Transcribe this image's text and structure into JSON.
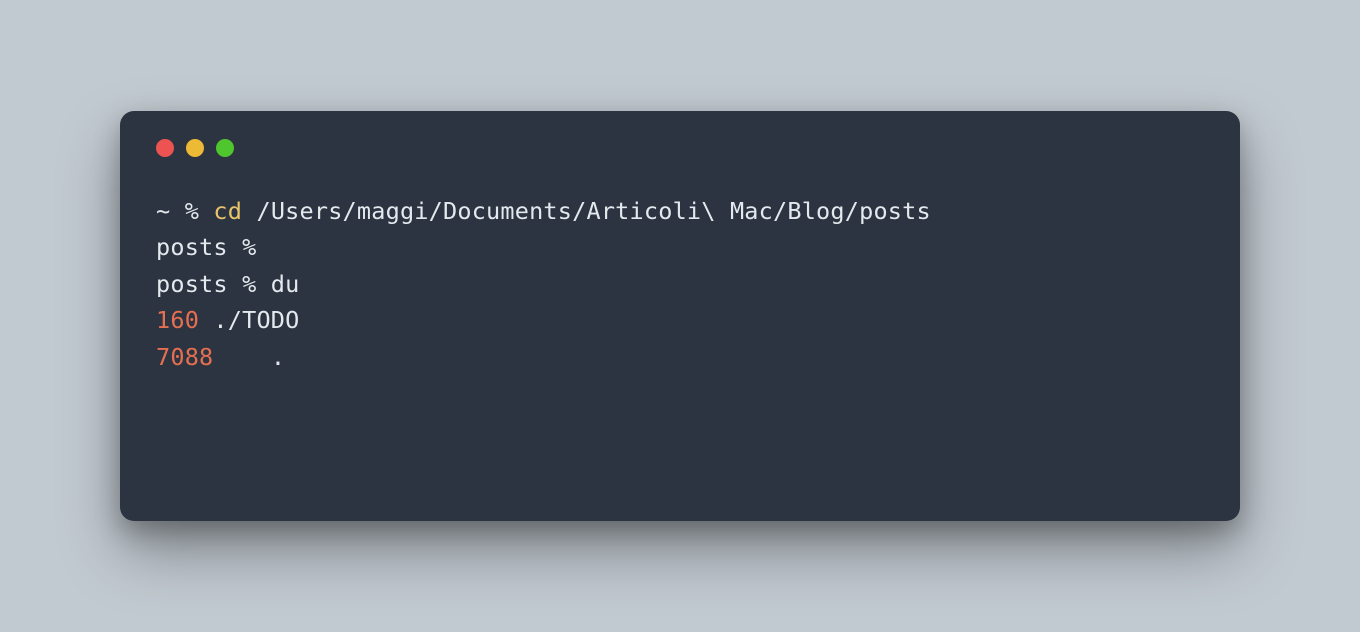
{
  "lines": [
    {
      "prompt": "~ %",
      "command": "cd",
      "arg": "/Users/maggi/Documents/Articoli\\ Mac/Blog/posts"
    },
    {
      "prompt": "posts %",
      "command": "",
      "arg": ""
    },
    {
      "prompt": "posts %",
      "command": "du",
      "arg": ""
    }
  ],
  "output": [
    {
      "size": "160",
      "path": "./TODO"
    },
    {
      "size": "7088",
      "path": "."
    }
  ]
}
